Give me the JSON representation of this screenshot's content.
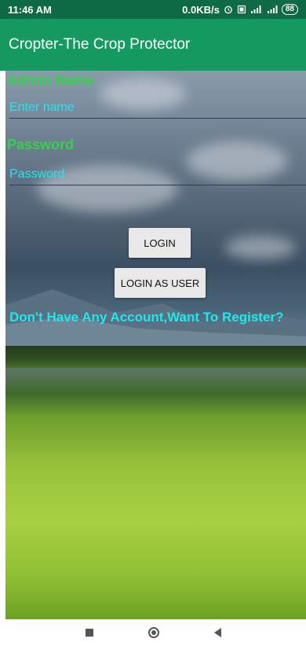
{
  "status_bar": {
    "time": "11:46 AM",
    "network_speed": "0.0KB/s",
    "alarm_icon": "alarm-icon",
    "signal_icon": "signal-icon",
    "battery": "88"
  },
  "app_bar": {
    "title": "Cropter-The Crop Protector",
    "color": "#159a62"
  },
  "form": {
    "admin_label": "Admin Name",
    "name_placeholder": "Enter name",
    "password_label": "Password",
    "password_placeholder": "Password",
    "login_button": "LOGIN",
    "login_user_button": "LOGIN AS USER",
    "register_prompt": "Don't Have Any Account,Want To Register?"
  },
  "colors": {
    "label_green": "#33d24a",
    "accent_cyan": "#1ee8ee",
    "status_bar": "#0f6b45"
  },
  "nav_bar": {
    "recent_icon": "square-icon",
    "home_icon": "circle-icon",
    "back_icon": "back-triangle-icon"
  }
}
